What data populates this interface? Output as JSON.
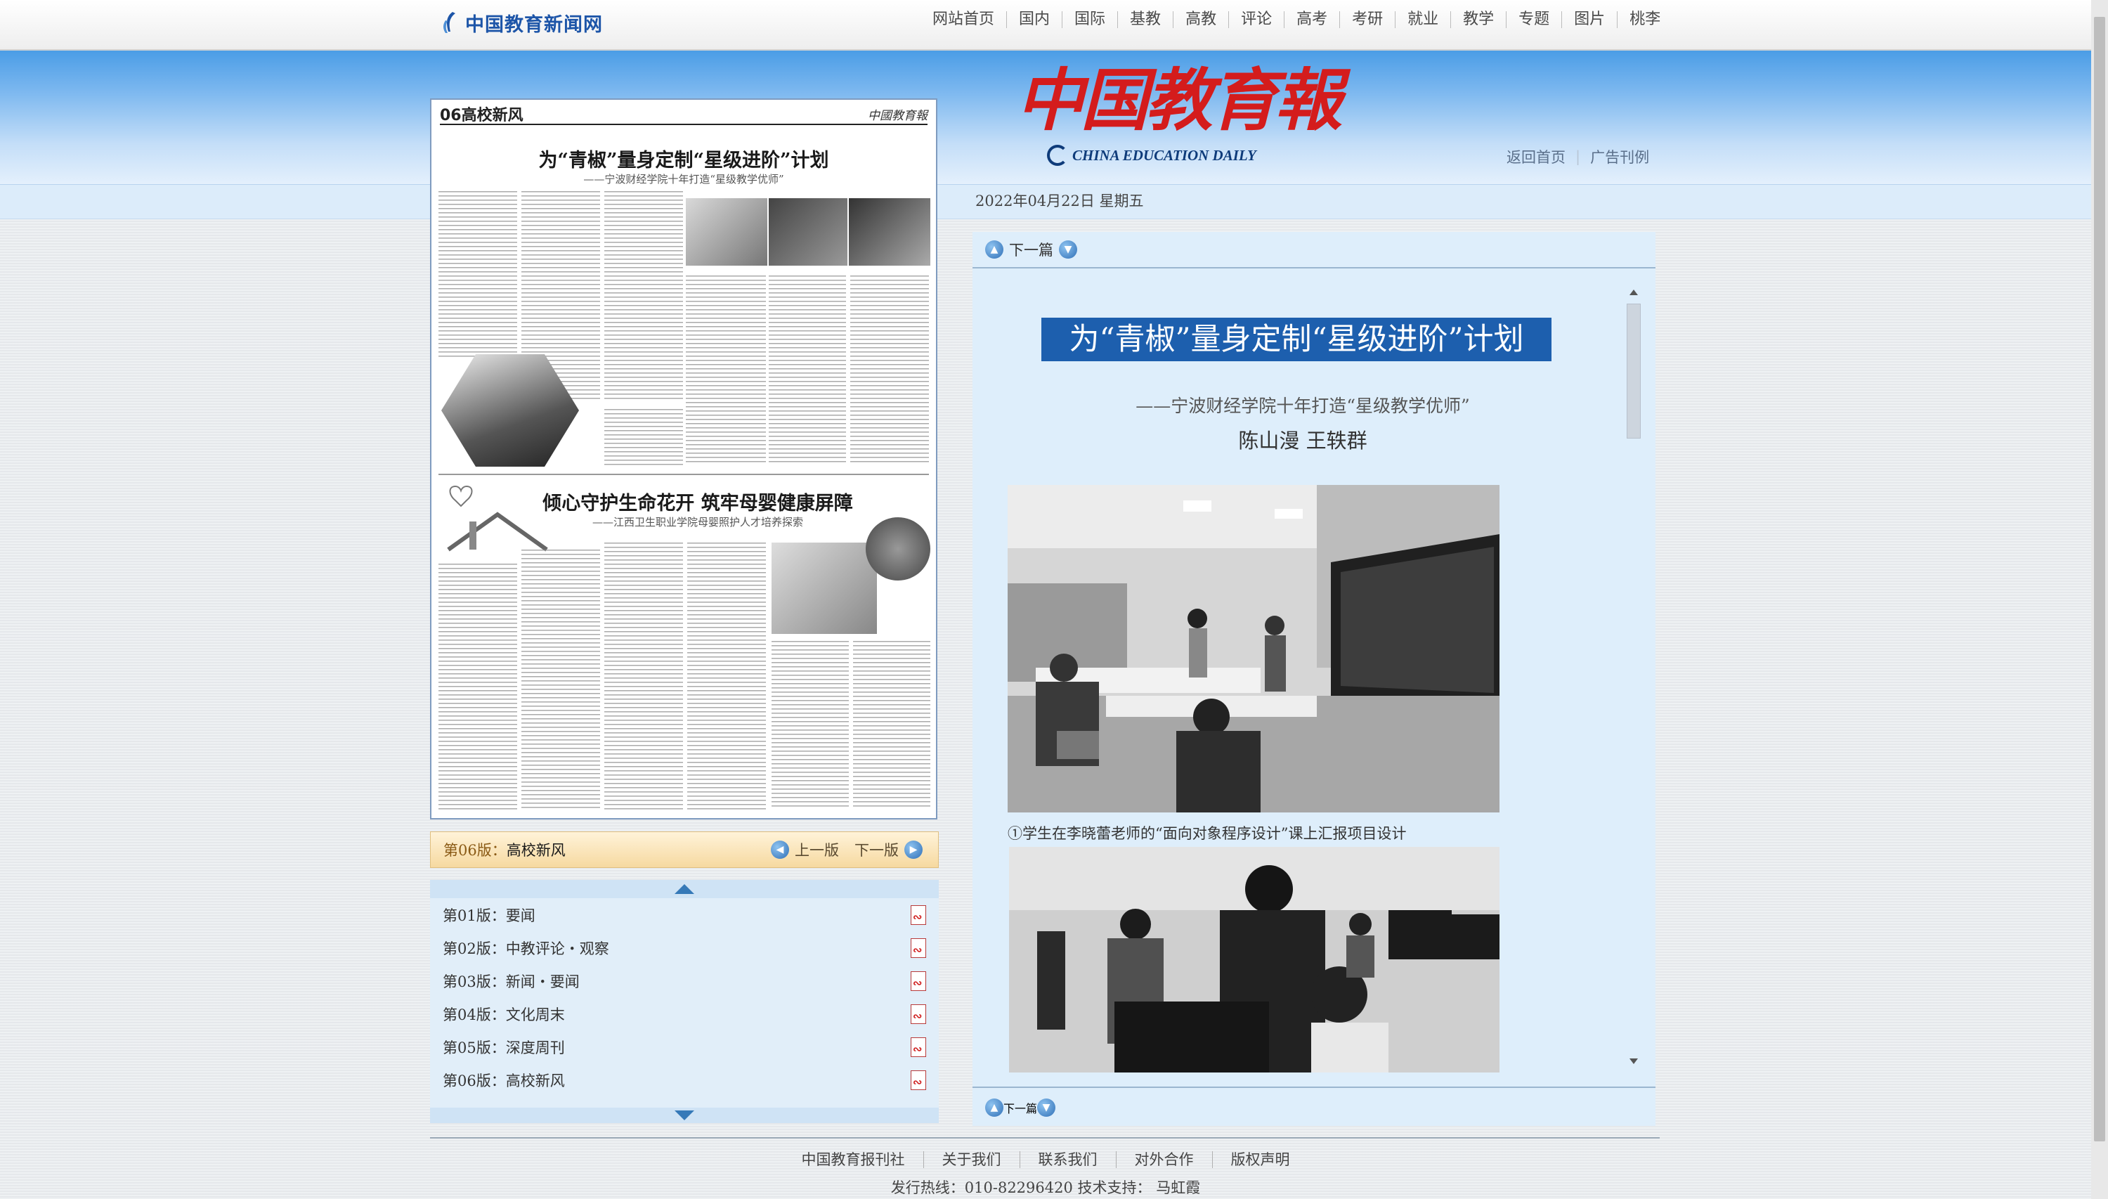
{
  "site": {
    "logo_text": "中国教育新闻网",
    "nav": [
      "网站首页",
      "国内",
      "国际",
      "基教",
      "高教",
      "评论",
      "高考",
      "考研",
      "就业",
      "教学",
      "专题",
      "图片",
      "桃李"
    ]
  },
  "masthead": {
    "title_cn": "中国教育報",
    "title_en": "CHINA EDUCATION DAILY",
    "links": [
      "返回首页",
      "广告刊例"
    ],
    "date": "2022年04月22日  星期五"
  },
  "newspaper_thumb": {
    "page_label": "06高校新风",
    "mast": "中國教育報",
    "headline1": "为“青椒”量身定制“星级进阶”计划",
    "sub1": "——宁波财经学院十年打造“星级教学优师”",
    "headline2": "倾心守护生命花开  筑牢母婴健康屏障",
    "sub2": "——江西卫生职业学院母婴照护人才培养探索"
  },
  "page_nav": {
    "current_prefix": "第06版：",
    "current_name": "高校新风",
    "prev": "上一版",
    "next": "下一版"
  },
  "page_list": [
    {
      "label": "第01版：要闻"
    },
    {
      "label": "第02版：中教评论・观察"
    },
    {
      "label": "第03版：新闻・要闻"
    },
    {
      "label": "第04版：文化周末"
    },
    {
      "label": "第05版：深度周刊"
    },
    {
      "label": "第06版：高校新风"
    }
  ],
  "article": {
    "next_label": "下一篇",
    "title": "为“青椒”量身定制“星级进阶”计划",
    "subtitle": "——宁波财经学院十年打造“星级教学优师”",
    "authors": "陈山漫  王轶群",
    "caption1": "①学生在李晓蕾老师的“面向对象程序设计”课上汇报项目设计"
  },
  "footer": {
    "links": [
      "中国教育报刊社",
      "关于我们",
      "联系我们",
      "对外合作",
      "版权声明"
    ],
    "line2": "发行热线：010-82296420  技术支持：  马虹霞"
  },
  "colors": {
    "accent_blue": "#1d5fae",
    "masthead_red": "#d41c1c",
    "link_blue": "#1d55a8"
  },
  "icons": [
    "news-logo-icon",
    "prev-circle-icon",
    "next-circle-icon",
    "pdf-icon",
    "arrow-up-icon",
    "arrow-down-icon"
  ]
}
